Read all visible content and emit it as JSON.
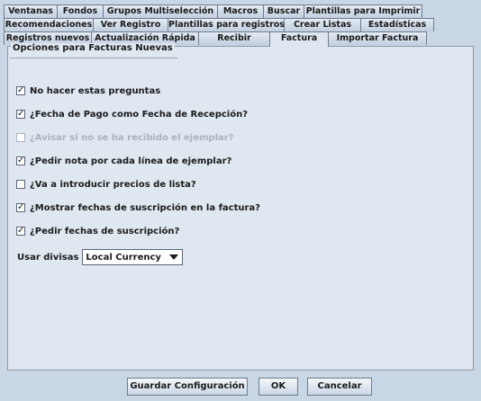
{
  "tabs": {
    "row1": [
      "Ventanas",
      "Fondos",
      "Grupos Multiselección",
      "Macros",
      "Buscar",
      "Plantillas para Imprimir"
    ],
    "row2": [
      "Recomendaciones",
      "Ver Registro",
      "Plantillas para registros",
      "Crear Listas",
      "Estadísticas"
    ],
    "row3": [
      "Registros nuevos",
      "Actualización Rápida",
      "Recibir",
      "Factura",
      "Importar Factura"
    ],
    "active": "Factura"
  },
  "group": {
    "title": "Opciones para Facturas Nuevas"
  },
  "options": [
    {
      "label": "No hacer estas preguntas",
      "checked": true,
      "enabled": true
    },
    {
      "label": "¿Fecha de Pago como Fecha de Recepción?",
      "checked": true,
      "enabled": true
    },
    {
      "label": "¿Avisar si no se ha recibido el ejemplar?",
      "checked": false,
      "enabled": false
    },
    {
      "label": "¿Pedir nota por cada línea de ejemplar?",
      "checked": true,
      "enabled": true
    },
    {
      "label": "¿Va a introducir precios de lista?",
      "checked": false,
      "enabled": true
    },
    {
      "label": "¿Mostrar fechas de suscripción en la factura?",
      "checked": true,
      "enabled": true
    },
    {
      "label": "¿Pedir fechas de suscripción?",
      "checked": true,
      "enabled": true
    }
  ],
  "currency": {
    "label": "Usar divisas",
    "value": "Local Currency"
  },
  "buttons": {
    "save": "Guardar Configuración",
    "ok": "OK",
    "cancel": "Cancelar"
  }
}
